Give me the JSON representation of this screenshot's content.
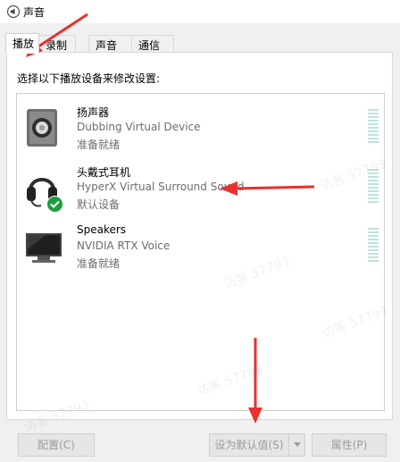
{
  "window": {
    "title": "声音"
  },
  "tabs": [
    {
      "label": "播放",
      "active": true
    },
    {
      "label": "录制",
      "active": false
    },
    {
      "label": "声音",
      "active": false
    },
    {
      "label": "通信",
      "active": false
    }
  ],
  "instruction": "选择以下播放设备来修改设置:",
  "devices": [
    {
      "name": "扬声器",
      "desc": "Dubbing Virtual Device",
      "status": "准备就绪",
      "icon": "speaker-icon"
    },
    {
      "name": "头戴式耳机",
      "desc": "HyperX Virtual Surround Sound",
      "status": "默认设备",
      "icon": "headset-icon",
      "default_badge": "check-badge-icon"
    },
    {
      "name": "Speakers",
      "desc": "NVIDIA RTX Voice",
      "status": "准备就绪",
      "icon": "monitor-icon"
    }
  ],
  "watermark": "访客 57793",
  "buttons": {
    "configure": "配置(C)",
    "set_default": "设为默认值(S)",
    "properties": "属性(P)"
  },
  "colors": {
    "annotation_arrow": "#e8312f",
    "meter": "#bfe3df",
    "default_check": "#1e9d3e"
  }
}
